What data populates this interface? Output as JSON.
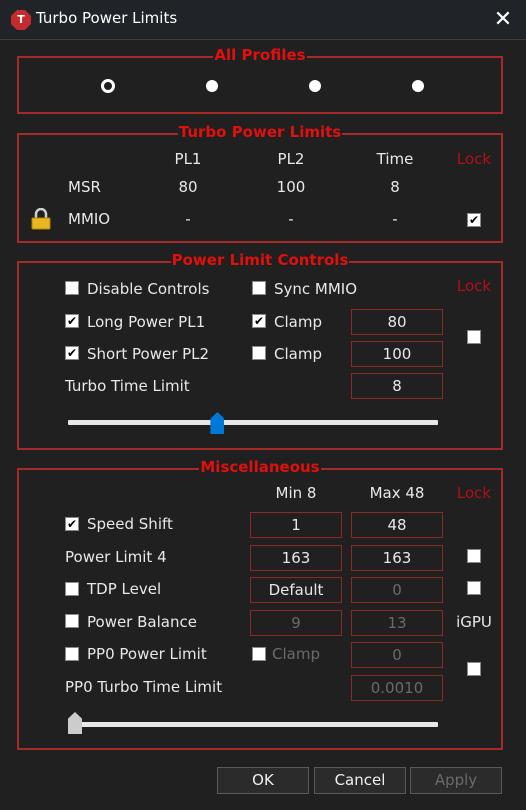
{
  "window": {
    "title": "Turbo Power Limits",
    "app_icon_letter": "T",
    "close_glyph": "✕"
  },
  "all_profiles": {
    "legend": "All Profiles",
    "profiles": [
      {
        "selected": true
      },
      {
        "selected": false
      },
      {
        "selected": false
      },
      {
        "selected": false
      }
    ]
  },
  "turbo_power_limits": {
    "legend": "Turbo Power Limits",
    "columns": [
      "PL1",
      "PL2",
      "Time"
    ],
    "lock_label": "Lock",
    "rows": [
      {
        "label": "MSR",
        "values": [
          "80",
          "100",
          "8"
        ]
      },
      {
        "label": "MMIO",
        "values": [
          "-",
          "-",
          "-"
        ],
        "locked_icon": "padlock-icon",
        "lock_checked": true
      }
    ]
  },
  "power_limit_controls": {
    "legend": "Power Limit Controls",
    "lock_label": "Lock",
    "disable_controls": {
      "label": "Disable Controls",
      "checked": false
    },
    "sync_mmio": {
      "label": "Sync MMIO",
      "checked": false
    },
    "long_power": {
      "label": "Long Power PL1",
      "checked": true,
      "clamp_label": "Clamp",
      "clamp_checked": true,
      "value": "80"
    },
    "short_power": {
      "label": "Short Power PL2",
      "checked": true,
      "clamp_label": "Clamp",
      "clamp_checked": false,
      "value": "100"
    },
    "turbo_time": {
      "label": "Turbo Time Limit",
      "value": "8",
      "slider_fraction": 0.4
    },
    "lock_checked": false
  },
  "miscellaneous": {
    "legend": "Miscellaneous",
    "min_label": "Min  8",
    "max_label": "Max  48",
    "lock_label": "Lock",
    "speed_shift": {
      "label": "Speed Shift",
      "checked": true,
      "min": "1",
      "max": "48"
    },
    "power_limit_4": {
      "label": "Power Limit 4",
      "min": "163",
      "max": "163",
      "lock_checked": false
    },
    "tdp_level": {
      "label": "TDP Level",
      "checked": false,
      "min": "Default",
      "max": "0",
      "lock_checked": false
    },
    "power_balance": {
      "label": "Power Balance",
      "checked": false,
      "min": "9",
      "max": "13",
      "igpu_label": "iGPU"
    },
    "pp0_power_limit": {
      "label": "PP0 Power Limit",
      "checked": false,
      "clamp_label": "Clamp",
      "clamp_checked": false,
      "value": "0",
      "lock_checked": false
    },
    "pp0_turbo_time": {
      "label": "PP0 Turbo Time Limit",
      "value": "0.0010",
      "slider_fraction": 0.0
    }
  },
  "buttons": {
    "ok": "OK",
    "cancel": "Cancel",
    "apply": "Apply"
  },
  "colors": {
    "accent_red": "#e0100e",
    "border_red": "#a52a2a",
    "thumb_blue": "#0078d7",
    "thumb_gray": "#cccccc"
  }
}
